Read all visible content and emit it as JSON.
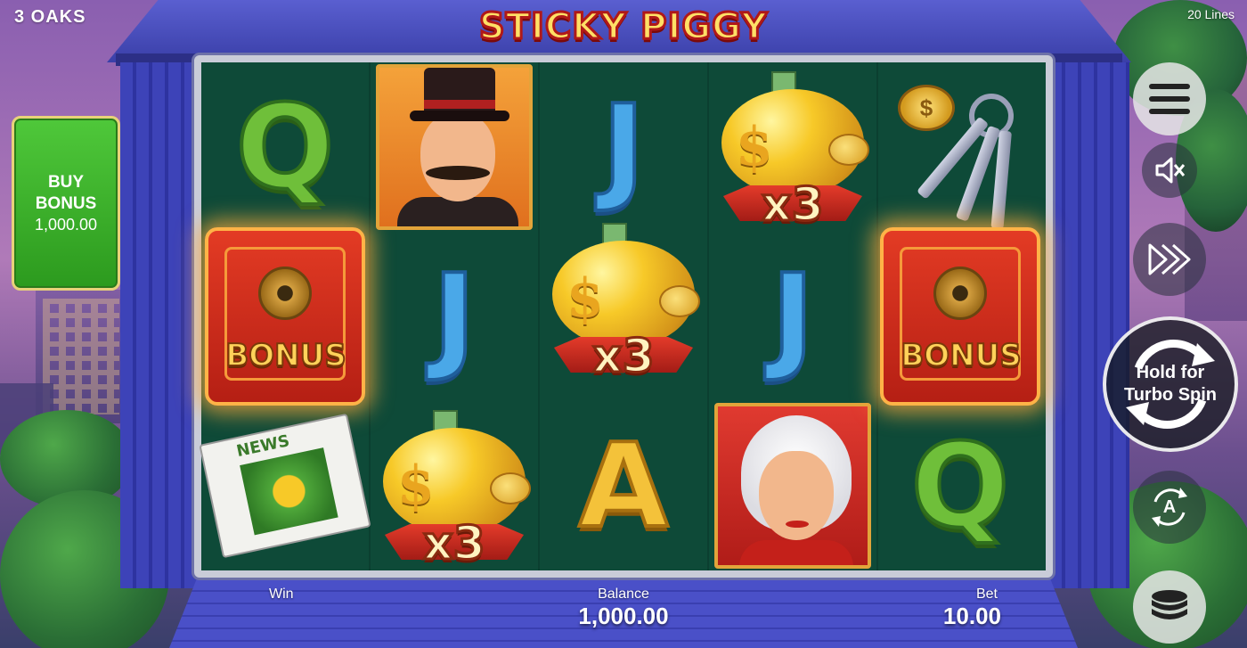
{
  "header": {
    "brand": "3 OAKS",
    "lines": "20 Lines",
    "logo": "STICKY PIGGY"
  },
  "buy_bonus": {
    "line1": "BUY",
    "line2": "BONUS",
    "price": "1,000.00"
  },
  "reels": [
    [
      "letter-Q",
      "bonus-safe",
      "newspaper"
    ],
    [
      "mobster-portrait",
      "letter-J",
      "golden-piggy"
    ],
    [
      "letter-J",
      "golden-piggy",
      "letter-A"
    ],
    [
      "golden-piggy",
      "letter-J",
      "lady-portrait"
    ],
    [
      "keys",
      "bonus-safe",
      "letter-Q"
    ]
  ],
  "symbols": {
    "q": "Q",
    "j": "J",
    "a": "A",
    "bonus": "BONUS",
    "multiplier": "x3",
    "news": "NEWS",
    "coin": "$"
  },
  "hud": {
    "win_label": "Win",
    "win_value": "",
    "balance_label": "Balance",
    "balance_value": "1,000.00",
    "bet_label": "Bet",
    "bet_value": "10.00"
  },
  "controls": {
    "spin_line1": "Hold for",
    "spin_line2": "Turbo Spin",
    "auto_letter": "A",
    "icons": [
      "menu-icon",
      "sound-muted-icon",
      "turbo-icon",
      "spin-icon",
      "autoplay-icon",
      "coins-icon"
    ]
  },
  "colors": {
    "reel_bg": "#0e4a38",
    "buy_bonus": "#3bb52a",
    "logo": "#ffe066"
  }
}
